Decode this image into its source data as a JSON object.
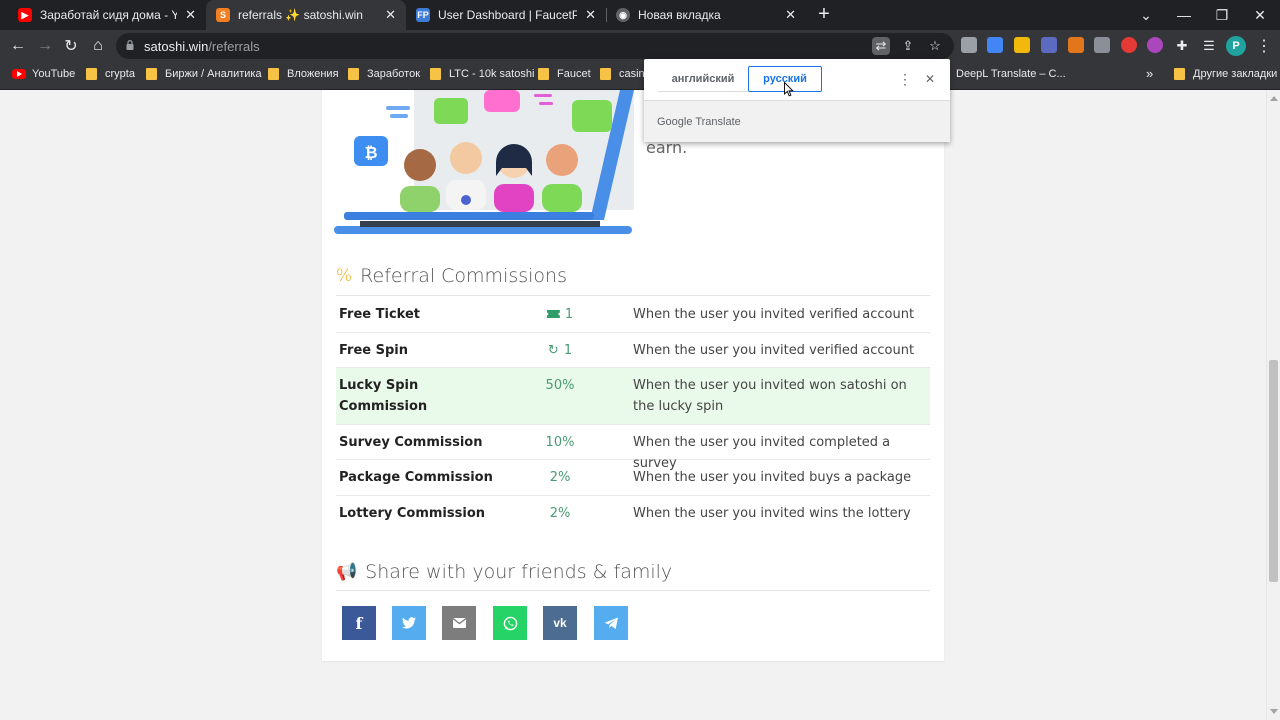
{
  "browser": {
    "tabs": [
      {
        "title": "Заработай сидя дома - YouTube",
        "favicon": "youtube-icon"
      },
      {
        "title": "referrals ✨ satoshi.win",
        "favicon": "satoshi-icon"
      },
      {
        "title": "User Dashboard | FaucetPay",
        "favicon": "faucetpay-icon"
      },
      {
        "title": "Новая вкладка",
        "favicon": "chrome-icon"
      }
    ],
    "url_host": "satoshi.win",
    "url_path": "/referrals",
    "profile_initial": "P",
    "bookmarks": [
      "YouTube",
      "crypta",
      "Биржи / Аналитика",
      "Вложения",
      "Заработок",
      "LTC - 10k satoshi",
      "Faucet",
      "casino",
      "DeepL Translate – C...",
      "»",
      "Другие закладки"
    ]
  },
  "translate_popup": {
    "source_lang": "английский",
    "target_lang": "русский",
    "footer": "Google Translate"
  },
  "page": {
    "intro_fragment": "earn.",
    "referral_title": "Referral Commissions",
    "commissions": [
      {
        "name": "Free Ticket",
        "value": "1",
        "icon": "ticket-icon",
        "description": "When the user you invited verified account",
        "highlight": false
      },
      {
        "name": "Free Spin",
        "value": "1",
        "icon": "spin-icon",
        "description": "When the user you invited verified account",
        "highlight": false
      },
      {
        "name": "Lucky Spin Commission",
        "value": "50%",
        "icon": "",
        "description": "When the user you invited won satoshi on the lucky spin",
        "highlight": true
      },
      {
        "name": "Survey Commission",
        "value": "10%",
        "icon": "",
        "description": "When the user you invited completed a survey",
        "highlight": false
      },
      {
        "name": "Package Commission",
        "value": "2%",
        "icon": "",
        "description": "When the user you invited buys a package",
        "highlight": false
      },
      {
        "name": "Lottery Commission",
        "value": "2%",
        "icon": "",
        "description": "When the user you invited wins the lottery",
        "highlight": false
      }
    ],
    "share_title": "Share with your friends & family",
    "share_buttons": [
      {
        "network": "facebook",
        "glyph": "f",
        "color": "#3b5998"
      },
      {
        "network": "twitter",
        "glyph": "🐦",
        "color": "#55acee"
      },
      {
        "network": "email",
        "glyph": "✉",
        "color": "#7d7d7d"
      },
      {
        "network": "whatsapp",
        "glyph": "✆",
        "color": "#25d366"
      },
      {
        "network": "vk",
        "glyph": "vk",
        "color": "#4c6c91"
      },
      {
        "network": "telegram",
        "glyph": "➤",
        "color": "#55acee"
      }
    ]
  },
  "colors": {
    "accent_gold": "#f0ad1f",
    "value_green": "#4a9a74",
    "highlight_row": "#eafaea",
    "translate_blue": "#1a73e8"
  }
}
